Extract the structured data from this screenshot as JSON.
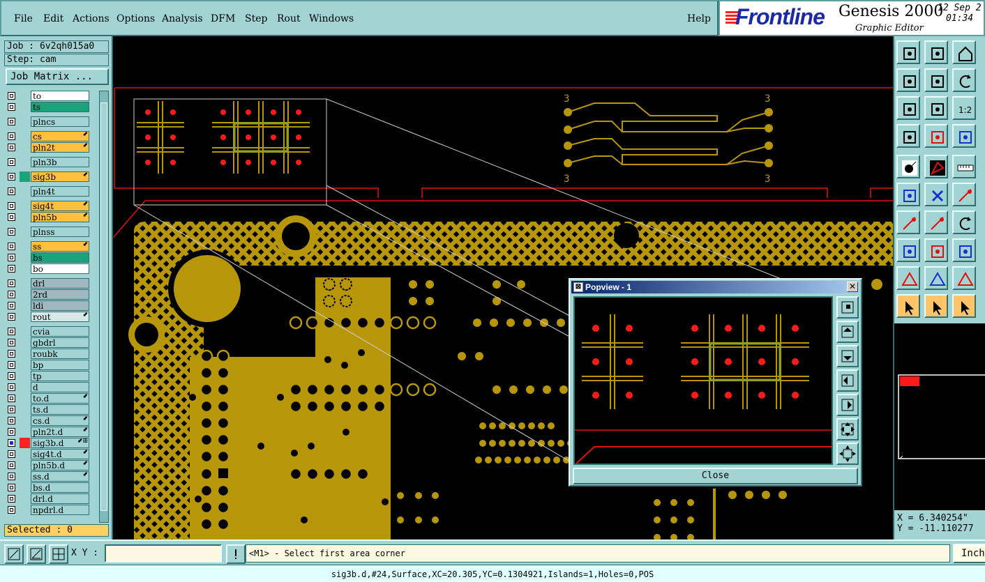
{
  "menu": [
    "File",
    "Edit",
    "Actions",
    "Options",
    "Analysis",
    "DFM",
    "Step",
    "Rout",
    "Windows"
  ],
  "help_label": "Help",
  "brand": {
    "logo": "Frontline",
    "product": "Genesis 2000",
    "subtitle": "Graphic Editor",
    "date": "12 Sep 2",
    "time": "01:34"
  },
  "job": "Job : 6v2qh015a0",
  "step": "Step: cam",
  "job_matrix_label": "Job Matrix ...",
  "layers": [
    {
      "name": "to",
      "color": "#ffffff",
      "mark": ""
    },
    {
      "name": "ts",
      "color": "#1aa37a",
      "mark": ""
    },
    {
      "name": "plncs",
      "color": "#a3d4d4",
      "mark": ""
    },
    {
      "name": "cs",
      "color": "#ffc040",
      "mark": "⬋"
    },
    {
      "name": "pln2t",
      "color": "#ffc040",
      "mark": "⬋"
    },
    {
      "name": "pln3b",
      "color": "#a3d4d4",
      "mark": ""
    },
    {
      "name": "sig3b",
      "color": "#ffc040",
      "mark": "⬋",
      "swatch": "#1aa37a"
    },
    {
      "name": "pln4t",
      "color": "#a3d4d4",
      "mark": ""
    },
    {
      "name": "sig4t",
      "color": "#ffc040",
      "mark": "⬋"
    },
    {
      "name": "pln5b",
      "color": "#ffc040",
      "mark": "⬋"
    },
    {
      "name": "plnss",
      "color": "#a3d4d4",
      "mark": ""
    },
    {
      "name": "ss",
      "color": "#ffc040",
      "mark": "⬋"
    },
    {
      "name": "bs",
      "color": "#1aa37a",
      "mark": ""
    },
    {
      "name": "bo",
      "color": "#ffffff",
      "mark": ""
    },
    {
      "name": "drl",
      "color": "#a0b8c0",
      "mark": ""
    },
    {
      "name": "2rd",
      "color": "#a0b8c0",
      "mark": ""
    },
    {
      "name": "ldi",
      "color": "#a0b8c0",
      "mark": ""
    },
    {
      "name": "rout",
      "color": "#d8e8e8",
      "mark": "⬋"
    },
    {
      "name": "cvia",
      "color": "#a3d4d4",
      "mark": ""
    },
    {
      "name": "gbdrl",
      "color": "#a3d4d4",
      "mark": ""
    },
    {
      "name": "roubk",
      "color": "#a3d4d4",
      "mark": ""
    },
    {
      "name": "bp",
      "color": "#a3d4d4",
      "mark": ""
    },
    {
      "name": "tp",
      "color": "#a3d4d4",
      "mark": ""
    },
    {
      "name": "d",
      "color": "#a3d4d4",
      "mark": ""
    },
    {
      "name": "to.d",
      "color": "#a3d4d4",
      "mark": "⬋"
    },
    {
      "name": "ts.d",
      "color": "#a3d4d4",
      "mark": ""
    },
    {
      "name": "cs.d",
      "color": "#a3d4d4",
      "mark": "⬋"
    },
    {
      "name": "pln2t.d",
      "color": "#a3d4d4",
      "mark": "⬋"
    },
    {
      "name": "sig3b.d",
      "color": "#a3d4d4",
      "mark": "⬋⊞",
      "swatch": "#ff2020",
      "active": true
    },
    {
      "name": "sig4t.d",
      "color": "#a3d4d4",
      "mark": "⬋"
    },
    {
      "name": "pln5b.d",
      "color": "#a3d4d4",
      "mark": "⬋"
    },
    {
      "name": "ss.d",
      "color": "#a3d4d4",
      "mark": "⬋"
    },
    {
      "name": "bs.d",
      "color": "#a3d4d4",
      "mark": ""
    },
    {
      "name": "drl.d",
      "color": "#a3d4d4",
      "mark": ""
    },
    {
      "name": "npdrl.d",
      "color": "#a3d4d4",
      "mark": ""
    }
  ],
  "selected": "Selected : 0",
  "cmd": {
    "xy_label": "X Y :",
    "xy_value": "",
    "prompt": "<M1> - Select first area corner",
    "unit": "Inch"
  },
  "coords": {
    "x": "X = 6.340254\"",
    "y": "Y = -11.110277"
  },
  "status": "sig3b.d,#24,Surface,XC=20.305,YC=0.1304921,Islands=1,Holes=0,POS",
  "popview": {
    "title": "Popview - 1",
    "close_label": "Close"
  },
  "canvas_labels": {
    "ref": "3"
  },
  "colors": {
    "copper": "#b8960a",
    "pad_red": "#ff1a1a",
    "outline_red": "#e01010",
    "panel": "#a3d4d4",
    "highlight_orange": "#ffc040"
  }
}
